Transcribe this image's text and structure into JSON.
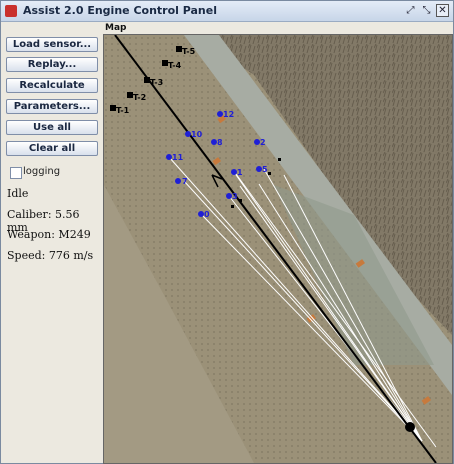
{
  "window": {
    "title": "Assist 2.0 Engine Control Panel"
  },
  "sidebar": {
    "buttons": [
      "Load sensor...",
      "Replay...",
      "Recalculate",
      "Parameters...",
      "Use all",
      "Clear all"
    ],
    "logging_label": "logging",
    "status": "Idle",
    "caliber": "Caliber: 5.56 mm",
    "weapon": "Weapon: M249",
    "speed": "Speed: 776 m/s"
  },
  "map": {
    "label": "Map",
    "targets": [
      "T-1",
      "T-2",
      "T-3",
      "T-4",
      "T-5"
    ],
    "sensors": [
      "0",
      "1",
      "2",
      "3",
      "5",
      "7",
      "8",
      "9",
      "10",
      "11",
      "12"
    ],
    "colors": {
      "sensor": "#1f1fd6",
      "track": "#000000",
      "target": "#000000",
      "ray": "#ffffff"
    }
  }
}
